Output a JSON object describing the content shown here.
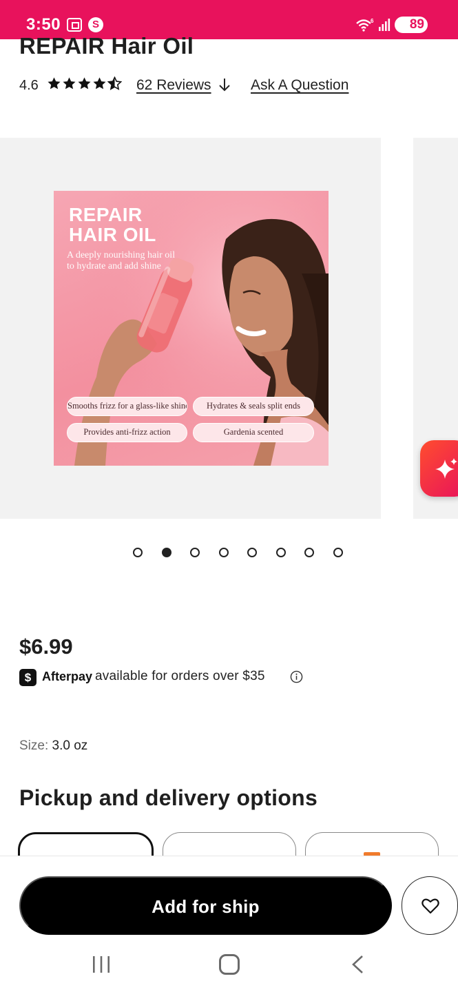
{
  "status_bar": {
    "time": "3:50",
    "battery": "89",
    "background": "#e8125c"
  },
  "product": {
    "title": "REPAIR Hair Oil",
    "rating": "4.6",
    "rating_stars": 4.6,
    "reviews_link": "62 Reviews",
    "ask_link": "Ask A Question"
  },
  "gallery": {
    "image_headline_line1": "REPAIR",
    "image_headline_line2": "HAIR OIL",
    "image_subtitle": "A deeply nourishing hair oil to hydrate and add shine",
    "image_pills": [
      "Smooths frizz for a glass-like shine",
      "Hydrates & seals split ends",
      "Provides anti-frizz action",
      "Gardenia scented"
    ],
    "total_slides": 8,
    "active_slide": 2
  },
  "pricing": {
    "price": "$6.99",
    "afterpay_brand": "Afterpay",
    "afterpay_text": "available for orders over $35"
  },
  "size": {
    "label": "Size:",
    "value": "3.0 oz"
  },
  "pickup": {
    "heading": "Pickup and delivery options"
  },
  "actions": {
    "add_button": "Add for ship"
  },
  "icons": {
    "rating": "star-icon",
    "reviews": "arrow-down-icon",
    "afterpay": "dollar-sign-icon",
    "info": "info-icon",
    "ai": "sparkle-icon",
    "wishlist": "heart-icon"
  },
  "colors": {
    "brand": "#e8125c",
    "image_bg": "#f3909f",
    "button": "#000000"
  }
}
